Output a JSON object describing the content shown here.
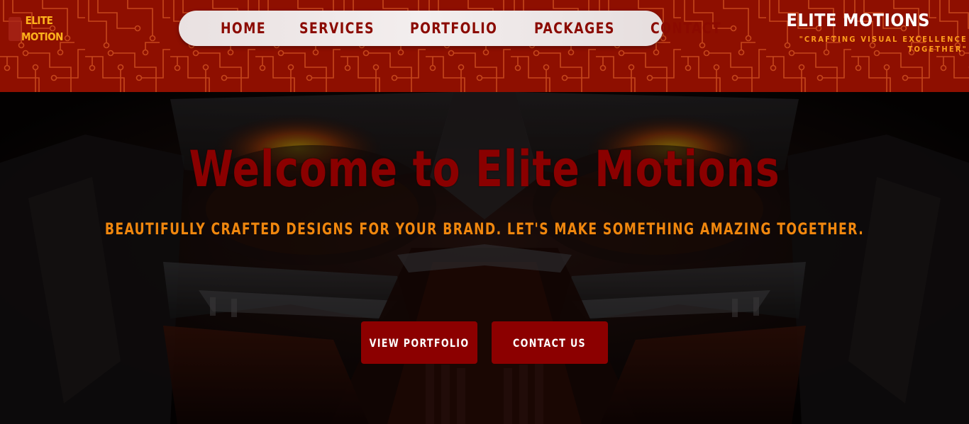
{
  "logo": {
    "line1": "ELITE",
    "line2": "MOTION"
  },
  "nav": {
    "items": [
      {
        "label": "HOME"
      },
      {
        "label": "SERVICES"
      },
      {
        "label": "PORTFOLIO"
      },
      {
        "label": "PACKAGES"
      },
      {
        "label": "CONTACT"
      }
    ]
  },
  "brand": {
    "name": "ELITE MOTIONS",
    "tagline": "\"CRAFTING VISUAL EXCELLENCE TOGETHER\""
  },
  "hero": {
    "title": "Welcome to Elite Motions",
    "subtitle": "BEAUTIFULLY CRAFTED DESIGNS FOR YOUR BRAND. LET'S MAKE SOMETHING AMAZING TOGETHER.",
    "buttons": {
      "portfolio": "VIEW PORTFOLIO",
      "contact": "CONTACT US"
    }
  },
  "colors": {
    "header_bg": "#8e0f00",
    "circuit": "#d2541f",
    "accent_orange": "#ff9d1c",
    "button_bg": "#8c0000",
    "nav_text": "#8b0a00"
  }
}
